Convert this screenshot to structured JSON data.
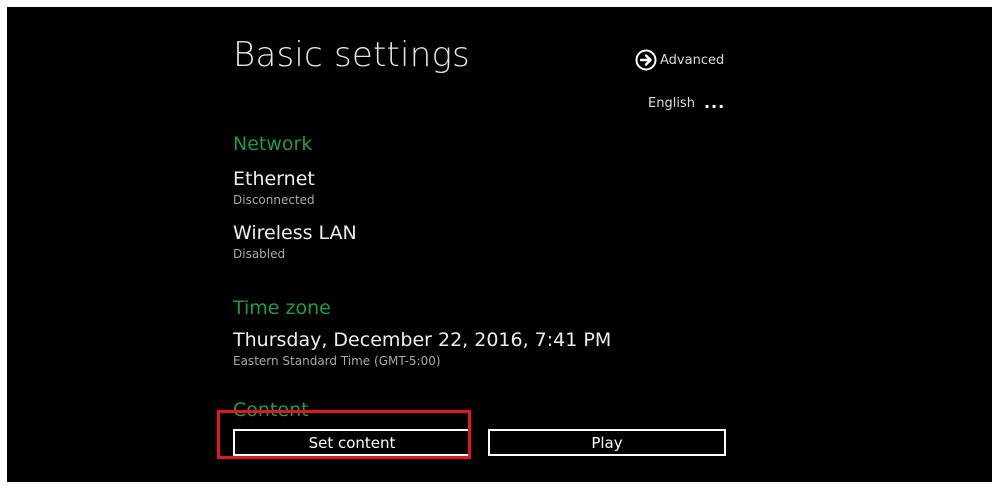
{
  "header": {
    "title": "Basic settings",
    "advanced_label": "Advanced",
    "advanced_icon": "arrow-right-circle-icon",
    "language_label": "English",
    "language_more": "..."
  },
  "sections": {
    "network": {
      "heading": "Network",
      "ethernet": {
        "label": "Ethernet",
        "status": "Disconnected"
      },
      "wireless": {
        "label": "Wireless LAN",
        "status": "Disabled"
      }
    },
    "timezone": {
      "heading": "Time zone",
      "datetime": "Thursday, December 22, 2016, 7:41 PM",
      "zone": "Eastern Standard Time (GMT-5:00)"
    },
    "content": {
      "heading": "Content",
      "set_content_label": "Set content",
      "play_label": "Play"
    }
  },
  "colors": {
    "background": "#000000",
    "section_heading": "#1f9a4a",
    "highlight": "#e1171e"
  }
}
